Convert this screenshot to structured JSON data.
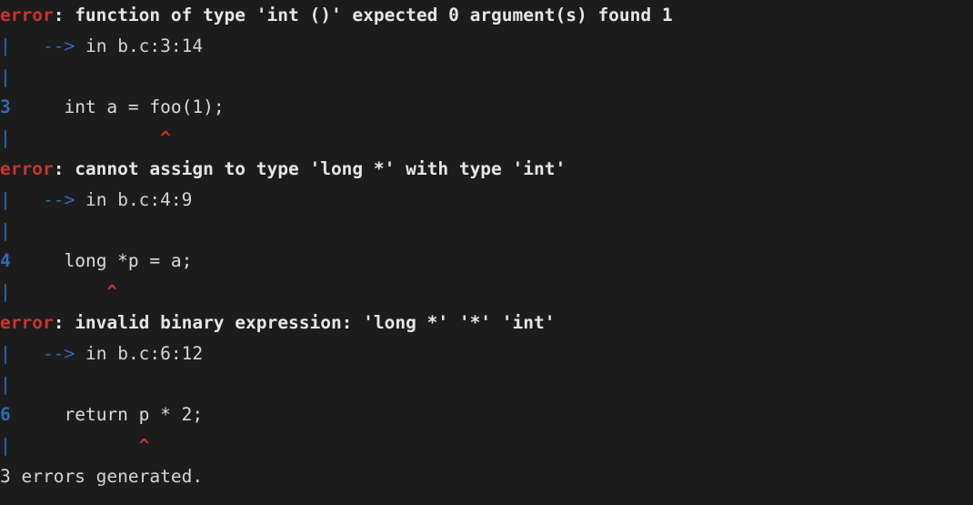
{
  "terminal": {
    "background_color": "#1c1c1c",
    "foreground_color": "#d8d8d8",
    "error_color": "#c5352e",
    "accent_color": "#2f6bb5",
    "summary": "3 errors generated."
  },
  "diagnostics": [
    {
      "severity_label": "error",
      "separator": ": ",
      "message": "function of type 'int ()' expected 0 argument(s) found 1",
      "gutter_pipe": "|",
      "arrow": "-->",
      "location_prefix": "in ",
      "location": "b.c:3:14",
      "line_number": "3",
      "code": "int a = foo(1);",
      "caret": "^",
      "caret_pad": "              ",
      "code_indent": "  "
    },
    {
      "severity_label": "error",
      "separator": ": ",
      "message": "cannot assign to type 'long *' with type 'int'",
      "gutter_pipe": "|",
      "arrow": "-->",
      "location_prefix": "in ",
      "location": "b.c:4:9",
      "line_number": "4",
      "code": "long *p = a;",
      "caret": "^",
      "caret_pad": "         ",
      "code_indent": "  "
    },
    {
      "severity_label": "error",
      "separator": ": ",
      "message": "invalid binary expression: 'long *' '*' 'int'",
      "gutter_pipe": "|",
      "arrow": "-->",
      "location_prefix": "in ",
      "location": "b.c:6:12",
      "line_number": "6",
      "code": "return p * 2;",
      "caret": "^",
      "caret_pad": "            ",
      "code_indent": "  "
    }
  ]
}
